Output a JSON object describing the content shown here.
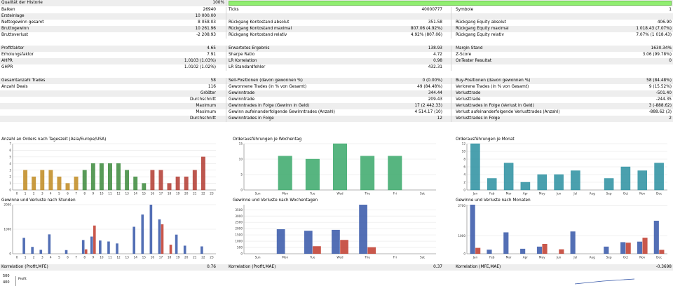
{
  "colors": {
    "stripe": "#eeeeee",
    "quality_fill": "#90ee70"
  },
  "quality": {
    "label": "Qualität der Historie",
    "value": "100%",
    "fraction": 1.0
  },
  "stats": {
    "r1": {
      "a_l": "Balken",
      "a_v": "26940",
      "b_l": "Ticks",
      "b_v": "40000777",
      "c_l": "Symbole",
      "c_v": "1"
    },
    "r2": {
      "a_l": "Ersteinlage",
      "a_v": "10 000.00"
    },
    "r3": {
      "a_l": "Nettogewinn gesamt",
      "a_v": "8 058.03",
      "b_l": "Rückgang Kontostand absolut",
      "b_v": "351.58",
      "c_l": "Rückgang Equity absolut",
      "c_v": "406.90"
    },
    "r4": {
      "a_l": "Bruttogewinn",
      "a_v": "10 261.96",
      "b_l": "Rückgang Kontostand maximal",
      "b_v": "807.06 (4.92%)",
      "c_l": "Rückgang Equity maximal",
      "c_v": "1 018.43 (7.07%)"
    },
    "r5": {
      "a_l": "Bruttoverlust",
      "a_v": "-2 208.93",
      "b_l": "Rückgang Kontostand relativ",
      "b_v": "4.92% (807.06)",
      "c_l": "Rückgang Equity relativ",
      "c_v": "7.07% (1 018.43)"
    },
    "r6": {
      "a_l": "Profitfaktor",
      "a_v": "4.65",
      "b_l": "Erwartetes Ergebnis",
      "b_v": "138.93",
      "c_l": "Margin Stand",
      "c_v": "1630.34%"
    },
    "r7": {
      "a_l": "Erholungsfaktor",
      "a_v": "7.91",
      "b_l": "Sharpe Ratio",
      "b_v": "4.72",
      "c_l": "Z-Score",
      "c_v": "3.06 (99.78%)"
    },
    "r8": {
      "a_l": "AHPR",
      "a_v": "1.0103 (1.03%)",
      "b_l": "LR Korrelation",
      "b_v": "0.98",
      "c_l": "OnTester Resultat",
      "c_v": "0"
    },
    "r9": {
      "a_l": "GHPR",
      "a_v": "1.0102 (1.02%)",
      "b_l": "LR Standardfehler",
      "b_v": "432.31"
    },
    "r10": {
      "a_l": "Gesamtanzahl Trades",
      "a_v": "58",
      "b_l": "Sell-Positionen (davon gewonnen %)",
      "b_v": "0 (0.00%)",
      "c_l": "Buy-Positionen (davon gewonnen %)",
      "c_v": "58 (84.48%)"
    },
    "r11": {
      "a_l": "Anzahl Deals",
      "a_v": "116",
      "b_l": "Gewonnene Trades (in % von Gesamt)",
      "b_v": "49 (84.48%)",
      "c_l": "Verlorene Trades (in % von Gesamt)",
      "c_v": "9 (15.52%)"
    },
    "r12": {
      "a_l": "Größter",
      "a_v": "",
      "b_l": "Gewinntrade",
      "b_v": "344.44",
      "c_l": "Verlusttrade",
      "c_v": "-501.40"
    },
    "r13": {
      "a_l": "Durchschnitt",
      "a_v": "",
      "b_l": "Gewinntrade",
      "b_v": "209.43",
      "c_l": "Verlusttrade",
      "c_v": "-244.35"
    },
    "r14": {
      "a_l": "Maximum",
      "a_v": "",
      "b_l": "Gewinntrades in Folge (Gewinn in Geld)",
      "b_v": "17 (2 442.33)",
      "c_l": "Verlusttrades in Folge (Verlust in Geld)",
      "c_v": "3 (-888.62)"
    },
    "r15": {
      "a_l": "Maximum",
      "a_v": "",
      "b_l": "Gewinn aufeinanderfolgende Gewinntrades (Anzahl)",
      "b_v": "4 514.17 (10)",
      "c_l": "Verlust aufeinanderfolgende Verlusttrades (Anzahl)",
      "c_v": "-888.62 (3)"
    },
    "r16": {
      "a_l": "Durchschnitt",
      "a_v": "",
      "b_l": "Gewinntrades in Folge",
      "b_v": "12",
      "c_l": "Verlusttrades in Folge",
      "c_v": "2"
    }
  },
  "corr": {
    "a_l": "Korrelation (Profit,MFE)",
    "a_v": "0.76",
    "b_l": "Korrelation (Profit,MAE)",
    "b_v": "0.37",
    "c_l": "Korrelation (MFE,MAE)",
    "c_v": "-0.3698"
  },
  "bottom": {
    "ylabel": "Profit",
    "ticks": [
      "500",
      "400"
    ]
  },
  "chart_data": [
    {
      "type": "bar",
      "title": "Anzahl an Orders nach Tageszeit (Asia/Europe/USA)",
      "categories": [
        "0",
        "1",
        "2",
        "3",
        "4",
        "5",
        "6",
        "7",
        "8",
        "9",
        "10",
        "11",
        "12",
        "13",
        "14",
        "15",
        "16",
        "17",
        "18",
        "19",
        "20",
        "21",
        "22",
        "23"
      ],
      "values": [
        0,
        3,
        2,
        3,
        3,
        2,
        1,
        2,
        3,
        4,
        4,
        4,
        4,
        3,
        2,
        1,
        3,
        3,
        1,
        2,
        2,
        3,
        5,
        0
      ],
      "colors": [
        "#c08a20",
        "#c08a20",
        "#c08a20",
        "#c08a20",
        "#c08a20",
        "#c08a20",
        "#c08a20",
        "#c08a20",
        "#3c8a3c",
        "#3c8a3c",
        "#3c8a3c",
        "#3c8a3c",
        "#3c8a3c",
        "#3c8a3c",
        "#3c8a3c",
        "#3c8a3c",
        "#b23a30",
        "#b23a30",
        "#b23a30",
        "#b23a30",
        "#b23a30",
        "#b23a30",
        "#b23a30",
        "#b23a30"
      ],
      "yticks": [
        "0",
        "1",
        "2",
        "3",
        "4",
        "5",
        "6",
        "7"
      ],
      "ylim": [
        0,
        7
      ]
    },
    {
      "type": "bar",
      "title": "Orderausführungen je Wochentag",
      "categories": [
        "Sun",
        "Mon",
        "Tue",
        "Wed",
        "Thu",
        "Fri",
        "Sat"
      ],
      "values": [
        0,
        11,
        10,
        15,
        11,
        11,
        0
      ],
      "colors": [
        "#3aa86a"
      ],
      "yticks": [
        "0",
        "5",
        "10",
        "15"
      ],
      "ylim": [
        0,
        15
      ]
    },
    {
      "type": "bar",
      "title": "Orderausführungen je Monat",
      "categories": [
        "Jan",
        "Feb",
        "Mar",
        "Apr",
        "May",
        "Jun",
        "Jul",
        "Aug",
        "Sep",
        "Oct",
        "Nov",
        "Dec"
      ],
      "values": [
        12,
        3,
        7,
        2,
        4,
        4,
        5,
        0,
        3,
        6,
        5,
        7
      ],
      "colors": [
        "#2a8fa0"
      ],
      "yticks": [
        "0",
        "2",
        "4",
        "6",
        "8",
        "10",
        "12"
      ],
      "ylim": [
        0,
        12
      ]
    },
    {
      "type": "bar",
      "title": "Gewinne und Verluste nach Stunden",
      "categories": [
        "0",
        "1",
        "2",
        "3",
        "4",
        "5",
        "6",
        "7",
        "8",
        "9",
        "10",
        "11",
        "12",
        "13",
        "14",
        "15",
        "16",
        "17",
        "18",
        "19",
        "20",
        "21",
        "22",
        "23"
      ],
      "series": [
        {
          "values": [
            0,
            650,
            280,
            160,
            790,
            0,
            150,
            0,
            560,
            700,
            540,
            500,
            420,
            0,
            1100,
            1600,
            2000,
            1400,
            0,
            780,
            330,
            0,
            300,
            0
          ]
        },
        {
          "values": [
            0,
            0,
            0,
            0,
            0,
            0,
            0,
            0,
            180,
            1150,
            0,
            0,
            0,
            0,
            0,
            0,
            0,
            1200,
            370,
            0,
            0,
            0,
            0,
            0
          ]
        }
      ],
      "series_colors": [
        "#3556a8",
        "#c0392b"
      ],
      "yticks": [
        "0",
        "1000",
        "2000"
      ],
      "ylim": [
        0,
        2000
      ]
    },
    {
      "type": "bar",
      "title": "Gewinne und Verluste nach Wochentagen",
      "categories": [
        "Sun",
        "Mon",
        "Tue",
        "Wed",
        "Thu",
        "Fri",
        "Sat"
      ],
      "series": [
        {
          "values": [
            0,
            1950,
            1830,
            1900,
            3900,
            0,
            0
          ]
        },
        {
          "values": [
            0,
            0,
            600,
            1100,
            520,
            0,
            0
          ]
        }
      ],
      "series_colors": [
        "#3556a8",
        "#c0392b"
      ],
      "yticks": [
        "0",
        "500",
        "1000",
        "1500",
        "2000",
        "2500",
        "3000",
        "3500"
      ],
      "ylim": [
        0,
        3900
      ]
    },
    {
      "type": "bar",
      "title": "Gewinne und Verluste nach Monaten",
      "categories": [
        "Jan",
        "Feb",
        "Mar",
        "Apr",
        "May",
        "Jun",
        "Jul",
        "Aug",
        "Sep",
        "Oct",
        "Nov",
        "Dec"
      ],
      "series": [
        {
          "values": [
            2750,
            230,
            1200,
            280,
            400,
            0,
            1250,
            0,
            400,
            650,
            680,
            1850
          ]
        },
        {
          "values": [
            330,
            0,
            0,
            0,
            550,
            250,
            0,
            0,
            0,
            620,
            900,
            220
          ]
        }
      ],
      "series_colors": [
        "#3556a8",
        "#c0392b"
      ],
      "yticks": [
        "0",
        "1000",
        "2700"
      ],
      "ylim": [
        0,
        2750
      ]
    }
  ]
}
